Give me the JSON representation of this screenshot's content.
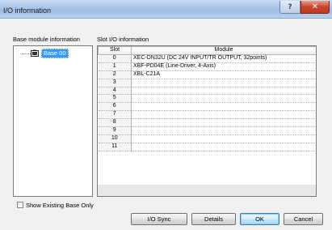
{
  "window": {
    "title": "I/O information",
    "help_glyph": "?",
    "close_glyph": "✕"
  },
  "left_panel": {
    "label": "Base module information",
    "tree_item": "Base 00"
  },
  "right_panel": {
    "label": "Slot I/O information",
    "columns": [
      "Slot",
      "Module"
    ],
    "rows": [
      {
        "slot": "0",
        "module": "XEC-DN32U (DC 24V INPUT/TR OUTPUT, 32points)"
      },
      {
        "slot": "1",
        "module": "XBF-PD04E (Line-Driver, 4-Axis)"
      },
      {
        "slot": "2",
        "module": "XBL-C21A"
      },
      {
        "slot": "3",
        "module": ""
      },
      {
        "slot": "4",
        "module": ""
      },
      {
        "slot": "5",
        "module": ""
      },
      {
        "slot": "6",
        "module": ""
      },
      {
        "slot": "7",
        "module": ""
      },
      {
        "slot": "8",
        "module": ""
      },
      {
        "slot": "9",
        "module": ""
      },
      {
        "slot": "10",
        "module": ""
      },
      {
        "slot": "11",
        "module": ""
      }
    ]
  },
  "checkbox": {
    "label": "Show Existing Base Only",
    "checked": false
  },
  "buttons": {
    "io_sync": "I/O Sync",
    "details": "Details",
    "ok": "OK",
    "cancel": "Cancel"
  }
}
